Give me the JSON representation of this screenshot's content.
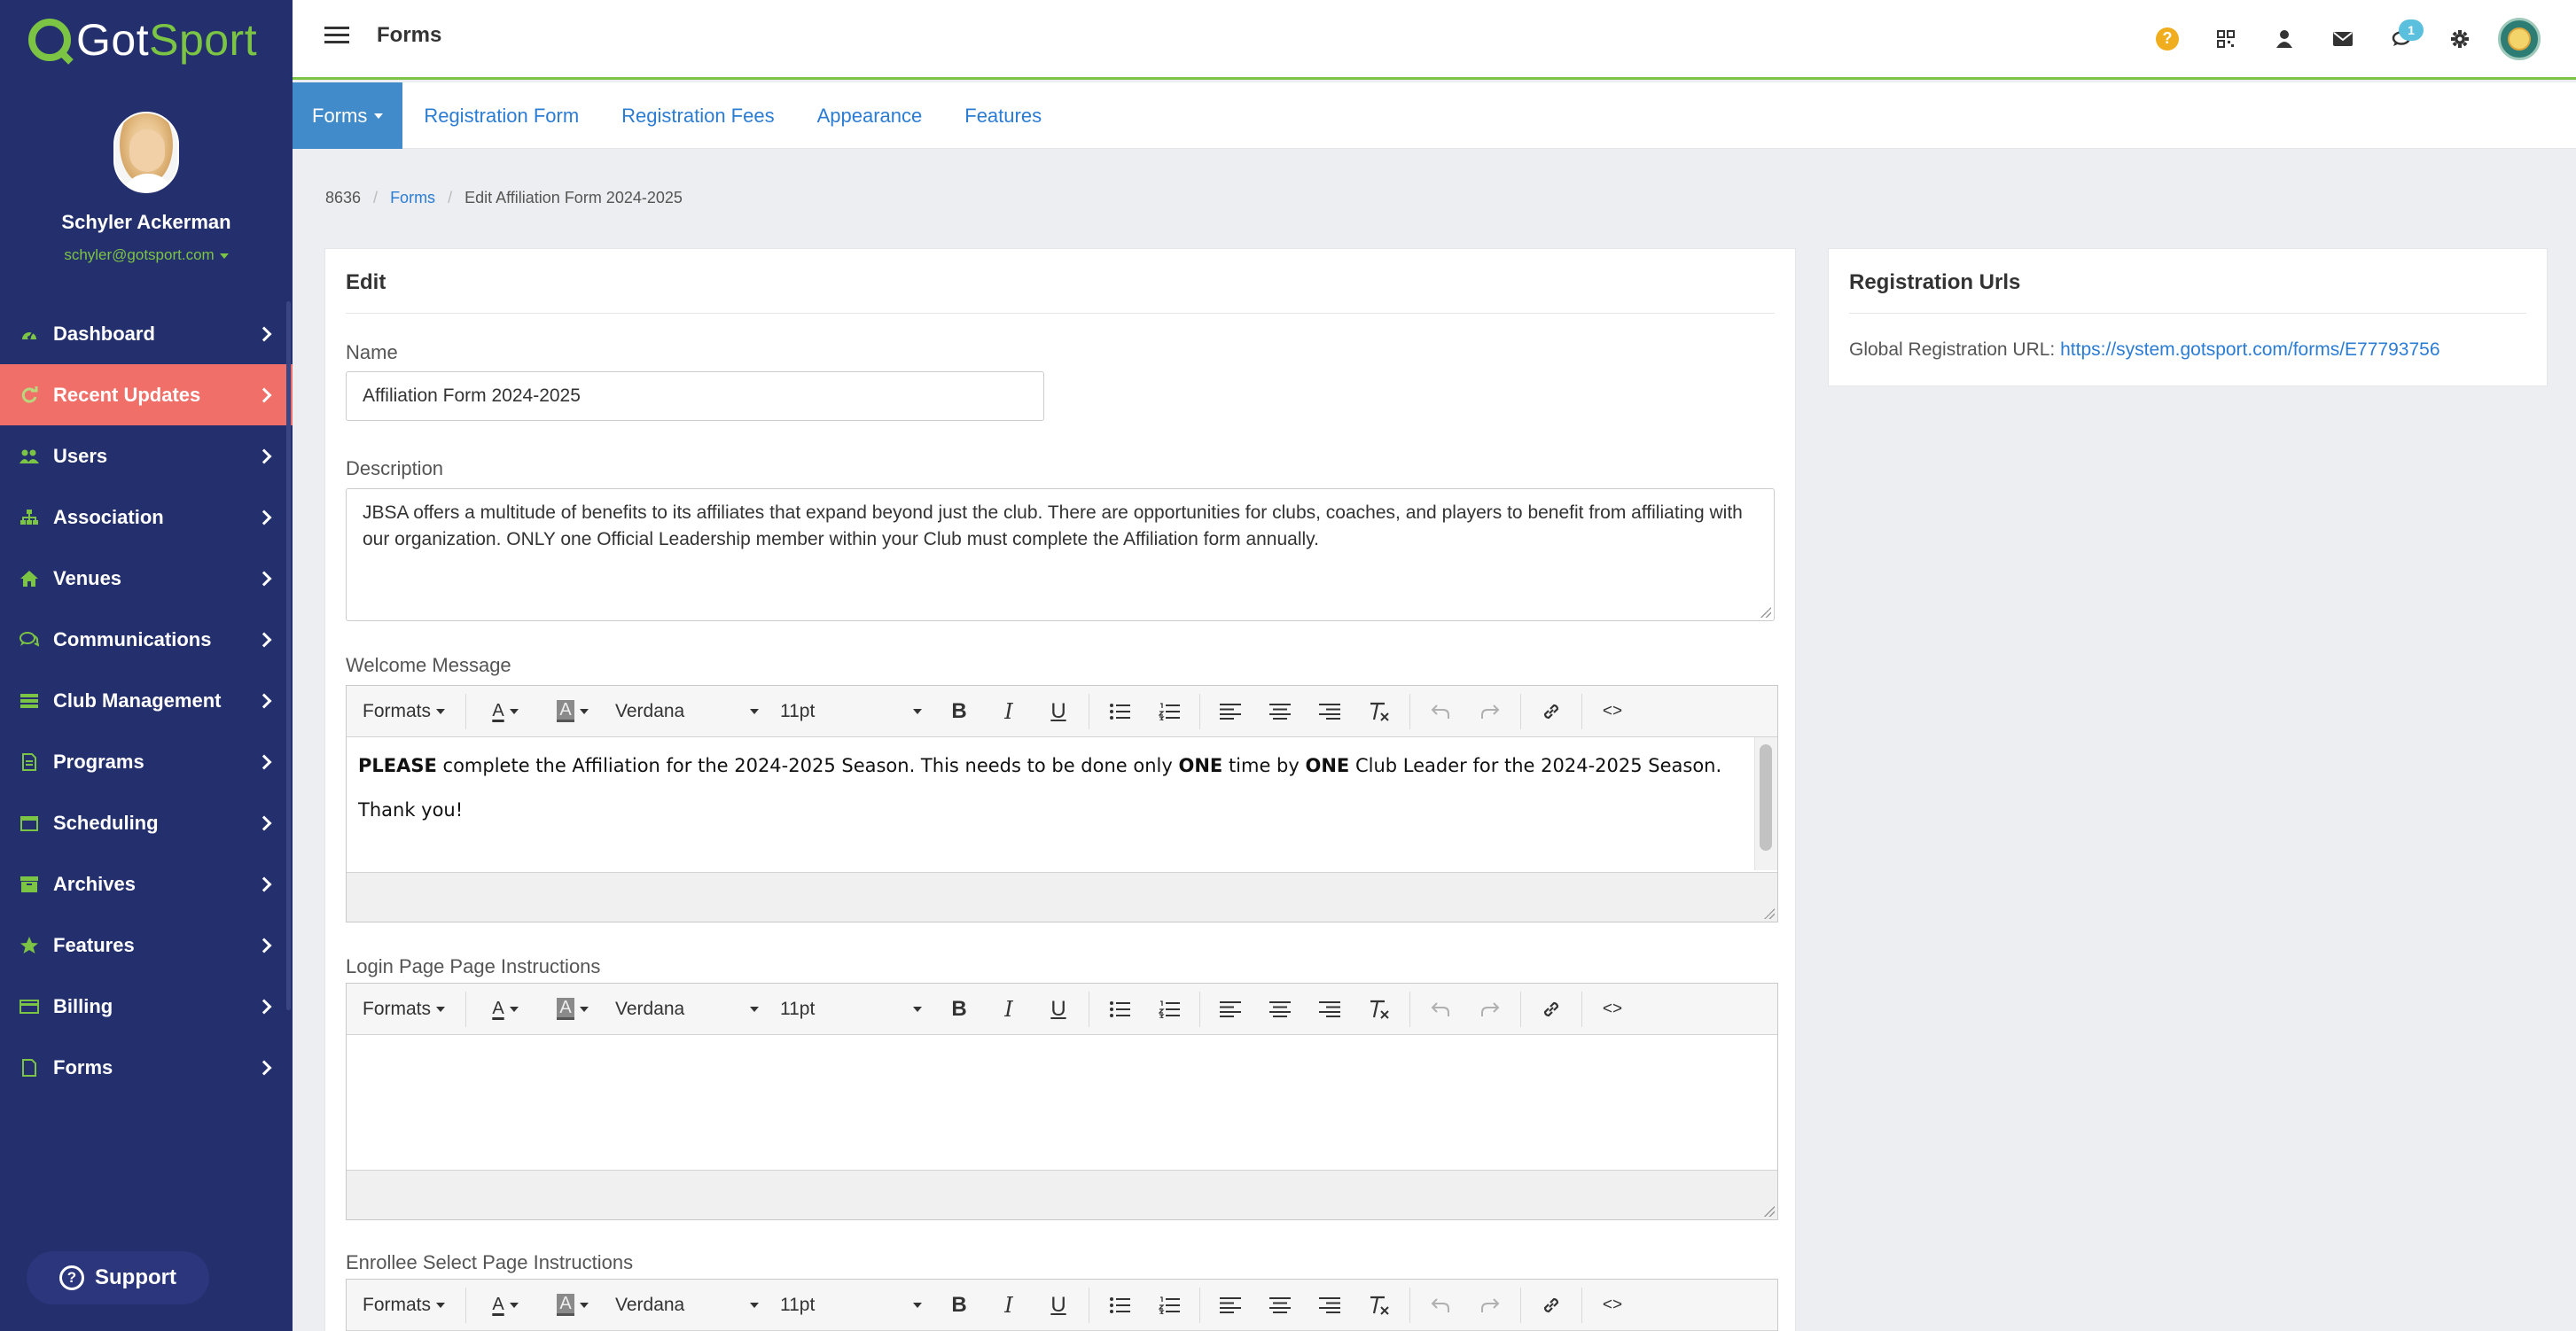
{
  "brand": {
    "got": "Got",
    "sport": "Sport",
    "accent": "#7cc444",
    "sidebar_bg": "#24306d",
    "active_bg": "#f06f68"
  },
  "profile": {
    "name": "Schyler Ackerman",
    "email": "schyler@gotsport.com"
  },
  "sidebar": {
    "items": [
      {
        "label": "Dashboard",
        "icon": "dashboard-icon"
      },
      {
        "label": "Recent Updates",
        "icon": "refresh-icon",
        "active": true
      },
      {
        "label": "Users",
        "icon": "users-icon"
      },
      {
        "label": "Association",
        "icon": "sitemap-icon"
      },
      {
        "label": "Venues",
        "icon": "home-icon"
      },
      {
        "label": "Communications",
        "icon": "comments-icon"
      },
      {
        "label": "Club Management",
        "icon": "list-icon"
      },
      {
        "label": "Programs",
        "icon": "document-icon"
      },
      {
        "label": "Scheduling",
        "icon": "calendar-icon"
      },
      {
        "label": "Archives",
        "icon": "archive-icon"
      },
      {
        "label": "Features",
        "icon": "star-icon"
      },
      {
        "label": "Billing",
        "icon": "credit-card-icon"
      },
      {
        "label": "Forms",
        "icon": "file-icon"
      }
    ],
    "support_label": "Support"
  },
  "header": {
    "title": "Forms",
    "notification_count": "1"
  },
  "tabs": [
    {
      "label": "Forms",
      "active": true
    },
    {
      "label": "Registration Form"
    },
    {
      "label": "Registration Fees"
    },
    {
      "label": "Appearance"
    },
    {
      "label": "Features"
    }
  ],
  "breadcrumb": {
    "id": "8636",
    "section": "Forms",
    "current": "Edit Affiliation Form 2024-2025"
  },
  "edit": {
    "title": "Edit",
    "name_label": "Name",
    "name_value": "Affiliation Form 2024-2025",
    "description_label": "Description",
    "description_value": "JBSA offers a multitude of benefits to its affiliates that expand beyond just the club. There are opportunities for clubs, coaches, and players to benefit from affiliating with our organization.  ONLY one Official Leadership member within your Club must complete the Affiliation form annually.",
    "welcome_label": "Welcome Message",
    "welcome": {
      "p1_bold1": "PLEASE",
      "p1_text1": " complete the Affiliation for the 2024-2025 Season. This needs to be done only ",
      "p1_bold2": "ONE",
      "p1_text2": " time by ",
      "p1_bold3": "ONE",
      "p1_text3": " Club Leader for the 2024-2025 Season.",
      "p2": "Thank you!"
    },
    "login_label": "Login Page Page Instructions",
    "enrollee_label": "Enrollee Select Page Instructions"
  },
  "toolbar": {
    "formats": "Formats",
    "font": "Verdana",
    "size": "11pt",
    "bold": "B",
    "italic": "I",
    "underline": "U",
    "code": "<>",
    "text_color": "A",
    "bg_color": "A"
  },
  "urls": {
    "title": "Registration Urls",
    "global_label": "Global Registration URL:",
    "global_url": "https://system.gotsport.com/forms/E77793756"
  }
}
